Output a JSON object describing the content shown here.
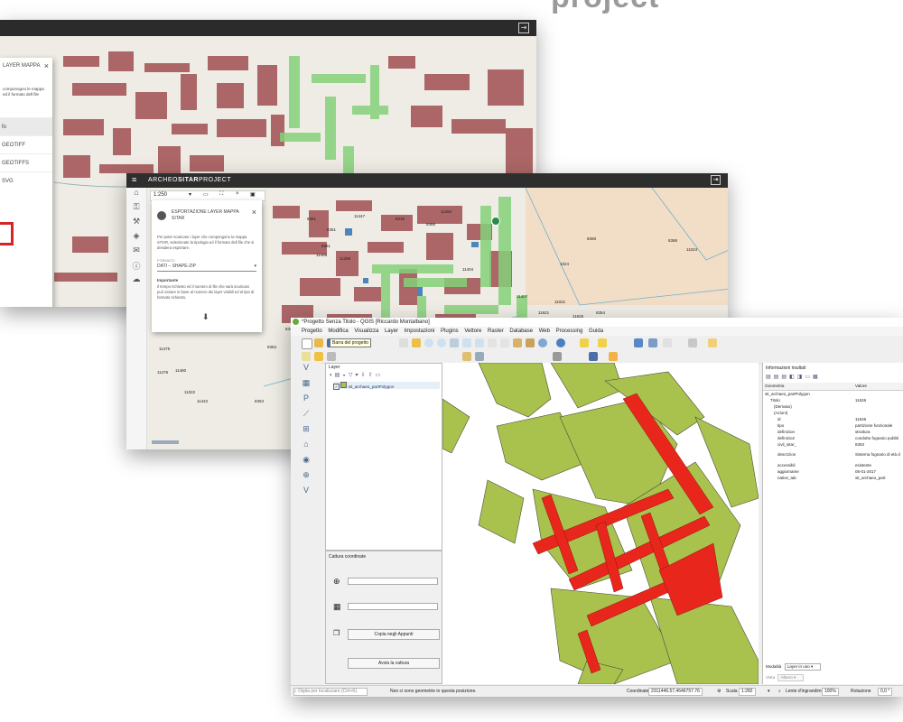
{
  "slogan": "project",
  "colors": {
    "map_bg": "#eeece4",
    "buildings": "#a5585a",
    "highlight_green": "#86d17a",
    "qgis_poly": "#a9c24e",
    "qgis_selected": "#e8261c",
    "accent_red": "#d42525"
  },
  "window_back": {
    "panel_title": "LAYER MAPPA",
    "panel_desc": "componogno le mappa ed il formato dell file",
    "options": [
      "fo",
      "GEOTIFF",
      "GEOTIFFS",
      "SVG"
    ]
  },
  "window_mid": {
    "brand_prefix": "ARCHEO",
    "brand_bold": "SITAR",
    "brand_suffix": "PROJECT",
    "scale": "1:250",
    "dialog": {
      "title": "ESPORTAZIONE LAYER MAPPA SITAR",
      "description": "Per poter scaricare i layer che compongono la mappa SITAR, selezionate la tipologia ed il formato dell file che si desidera esportare.",
      "format_label": "FORMATO",
      "format_value": "DATI – SHAPE-ZIP",
      "important_label": "Importante",
      "important_text": "Il tempo richiesto ed il numero di file che sarà scaricato può variare in base al numero dei layer visibili ed al tipo di formato richiesto."
    },
    "map_labels": [
      "8361",
      "8361",
      "11447",
      "11494",
      "8368",
      "8368",
      "11024",
      "11404",
      "8361",
      "11466",
      "11396",
      "11475",
      "11407",
      "8353",
      "8353",
      "11476",
      "11480",
      "11022",
      "11442",
      "8319",
      "8368",
      "11021",
      "8346",
      "11621",
      "11625",
      "8354",
      "1024"
    ]
  },
  "qgis": {
    "title": "*Progetto Senza Titolo - QGIS [Riccardo Montalbano]",
    "menu": [
      "Progetto",
      "Modifica",
      "Visualizza",
      "Layer",
      "Impostazioni",
      "Plugins",
      "Vettore",
      "Raster",
      "Database",
      "Web",
      "Processing",
      "Guida"
    ],
    "tooltip": "Barra del progetto",
    "layers_panel_title": "Layer",
    "layer_name": "sit_archaeo_partPolygon",
    "coord_panel_title": "Cattura coordinate",
    "copy_button": "Copia negli Appunti",
    "start_button": "Avvia la cattura",
    "info_panel_title": "Informazioni risultati",
    "info_headers": [
      "Geometria",
      "Valore"
    ],
    "info_rows": [
      {
        "k": "sit_archaeo_partPolygon",
        "v": ""
      },
      {
        "k": "Titolo",
        "v": "11626"
      },
      {
        "k": "(Derivato)",
        "v": ""
      },
      {
        "k": "(Azioni)",
        "v": ""
      },
      {
        "k": "id",
        "v": "11626"
      },
      {
        "k": "tipo",
        "v": "partizione funzionale"
      },
      {
        "k": "definizion",
        "v": "struttura"
      },
      {
        "k": "definizio2",
        "v": "condotto fognario pubbli"
      },
      {
        "k": "civil_sitar_",
        "v": "8353"
      },
      {
        "k": "descrizion",
        "v": "Sistema fognario di età d"
      },
      {
        "k": "accessibil",
        "v": "esistente"
      },
      {
        "k": "aggiorname",
        "v": "05-01-2017"
      },
      {
        "k": "native_tab",
        "v": "sit_archaeo_part"
      }
    ],
    "mode_label": "Modalità",
    "mode_value": "Layer in uso",
    "view_label": "Vista",
    "view_value": "Albero",
    "locator_placeholder": "Digita per localizzare (Ctrl+K)",
    "status_message": "Non ci sono geometrie in questa posizione.",
    "coord_label": "Coordinate",
    "coord_value": "2311446.57,4646757.76",
    "scale_label": "Scala",
    "scale_value": "1:282",
    "magnifier_label": "Lente d'ingrandimento",
    "magnifier_value": "100%",
    "rotation_label": "Rotazione",
    "rotation_value": "0,0 °"
  }
}
